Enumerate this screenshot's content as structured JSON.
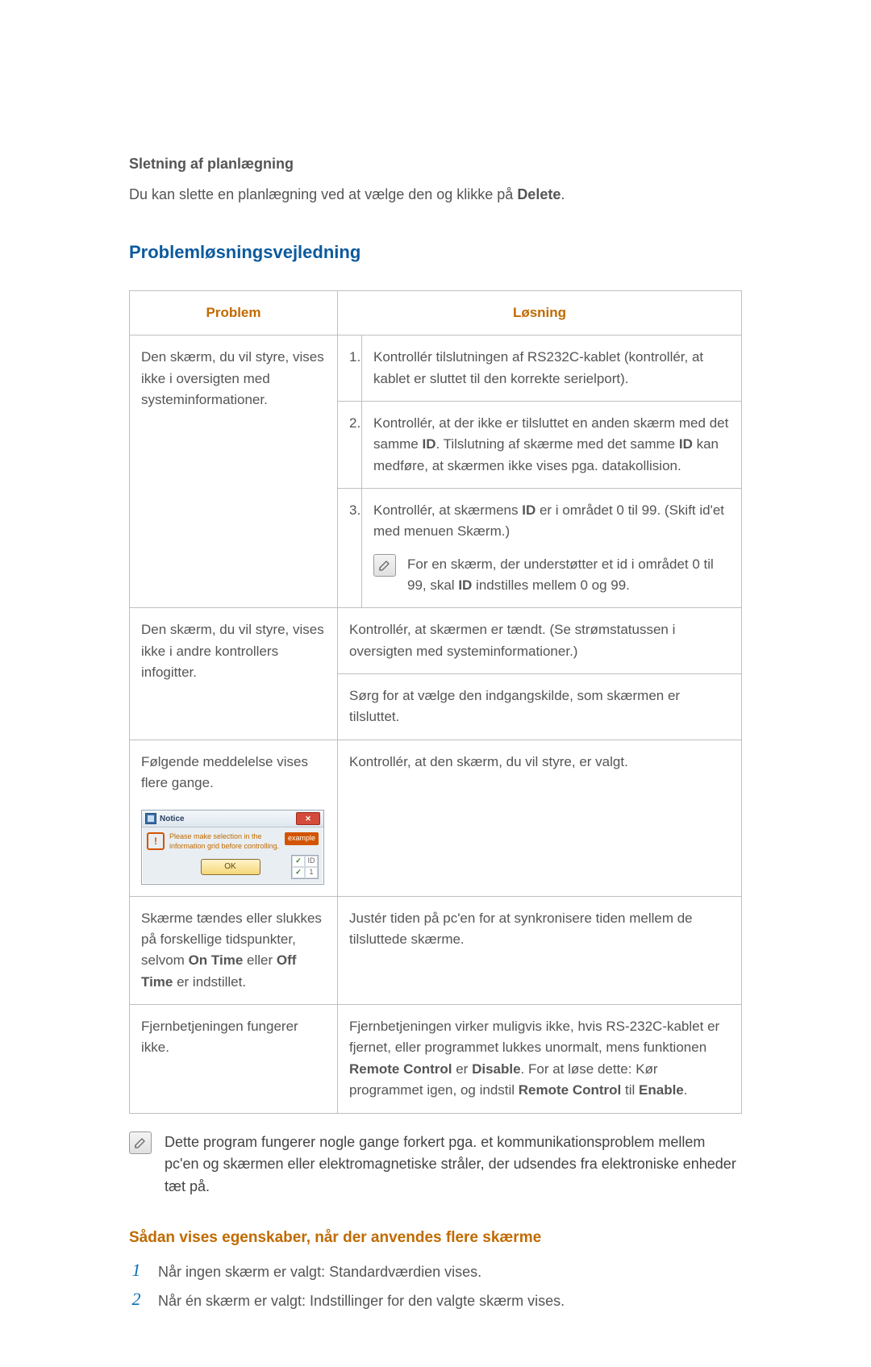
{
  "headings": {
    "delete_sched": "Sletning af planlægning",
    "delete_body_before": "Du kan slette en planlægning ved at vælge den og klikke på ",
    "delete_body_bold": "Delete",
    "delete_body_after": ".",
    "troubleshoot": "Problemløsningsvejledning",
    "properties_multi": "Sådan vises egenskaber, når der anvendes flere skærme"
  },
  "table": {
    "col_problem": "Problem",
    "col_solution": "Løsning",
    "row1_problem": "Den skærm, du vil styre, vises ikke i oversigten med systeminformationer.",
    "row1_s1_num": "1.",
    "row1_s1": "Kontrollér tilslutningen af RS232C-kablet (kontrollér, at kablet er sluttet til den korrekte serielport).",
    "row1_s2_num": "2.",
    "row1_s2_a": "Kontrollér, at der ikke er tilsluttet en anden skærm med det samme ",
    "row1_s2_b": "ID",
    "row1_s2_c": ". Tilslutning af skærme med det samme ",
    "row1_s2_d": "ID",
    "row1_s2_e": " kan medføre, at skærmen ikke vises pga. datakollision.",
    "row1_s3_num": "3.",
    "row1_s3_a": "Kontrollér, at skærmens ",
    "row1_s3_b": "ID",
    "row1_s3_c": " er i området 0 til 99. (Skift id'et med menuen Skærm.)",
    "row1_s3_note_a": "For en skærm, der understøtter et id i området 0 til 99, skal ",
    "row1_s3_note_b": "ID",
    "row1_s3_note_c": " indstilles mellem 0 og 99.",
    "row2_problem": "Den skærm, du vil styre, vises ikke i andre kontrollers infogitter.",
    "row2_s1": "Kontrollér, at skærmen er tændt. (Se strømstatussen i oversigten med systeminformationer.)",
    "row2_s2": "Sørg for at vælge den indgangskilde, som skærmen er tilsluttet.",
    "row3_problem": "Følgende meddelelse vises flere gange.",
    "row3_solution": "Kontrollér, at den skærm, du vil styre, er valgt.",
    "row4_problem_a": "Skærme tændes eller slukkes på forskellige tidspunkter, selvom ",
    "row4_problem_b": "On Time",
    "row4_problem_c": " eller ",
    "row4_problem_d": "Off Time",
    "row4_problem_e": " er indstillet.",
    "row4_solution": "Justér tiden på pc'en for at synkronisere tiden mellem de tilsluttede skærme.",
    "row5_problem": "Fjernbetjeningen fungerer ikke.",
    "row5_sol_a": "Fjernbetjeningen virker muligvis ikke, hvis RS-232C-kablet er fjernet, eller programmet lukkes unormalt, mens funktionen ",
    "row5_sol_b": "Remote Control",
    "row5_sol_c": " er ",
    "row5_sol_d": "Disable",
    "row5_sol_e": ". For at løse dette: Kør programmet igen, og indstil ",
    "row5_sol_f": "Remote Control",
    "row5_sol_g": " til ",
    "row5_sol_h": "Enable",
    "row5_sol_i": "."
  },
  "notice": {
    "title": "Notice",
    "msg": "Please make selection in the information grid before controlling.",
    "example": "example",
    "ok": "OK",
    "id_label": "ID",
    "id_val": "1"
  },
  "footer_note": "Dette program fungerer nogle gange forkert pga. et kommunikationsproblem mellem pc'en og skærmen eller elektromagnetiske stråler, der udsendes fra elektroniske enheder tæt på.",
  "steps": {
    "s1_num": "1",
    "s1": "Når ingen skærm er valgt: Standardværdien vises.",
    "s2_num": "2",
    "s2": "Når én skærm er valgt: Indstillinger for den valgte skærm vises."
  }
}
